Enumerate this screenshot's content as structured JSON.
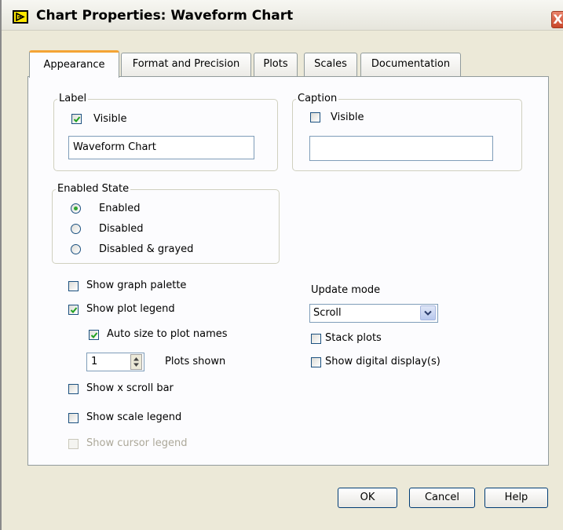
{
  "window": {
    "title": "Chart Properties: Waveform Chart",
    "close_glyph": "X",
    "icon": "labview-icon"
  },
  "tabs": [
    {
      "label": "Appearance",
      "active": true
    },
    {
      "label": "Format and Precision",
      "active": false
    },
    {
      "label": "Plots",
      "active": false
    },
    {
      "label": "Scales",
      "active": false
    },
    {
      "label": "Documentation",
      "active": false
    }
  ],
  "label_group": {
    "title": "Label",
    "visible_label": "Visible",
    "visible_checked": true,
    "text_value": "Waveform Chart"
  },
  "caption_group": {
    "title": "Caption",
    "visible_label": "Visible",
    "visible_checked": false,
    "text_value": ""
  },
  "enabled_state": {
    "title": "Enabled State",
    "options": [
      {
        "label": "Enabled",
        "selected": true
      },
      {
        "label": "Disabled",
        "selected": false
      },
      {
        "label": "Disabled & grayed",
        "selected": false
      }
    ]
  },
  "options": {
    "show_graph_palette": {
      "label": "Show graph palette",
      "checked": false
    },
    "show_plot_legend": {
      "label": "Show plot legend",
      "checked": true
    },
    "auto_size": {
      "label": "Auto size to plot names",
      "checked": true
    },
    "plots_shown": {
      "value": "1",
      "label": "Plots shown"
    },
    "show_x_scroll_bar": {
      "label": "Show x scroll bar",
      "checked": false
    },
    "show_scale_legend": {
      "label": "Show scale legend",
      "checked": false
    },
    "show_cursor_legend": {
      "label": "Show cursor legend",
      "checked": false,
      "disabled": true
    }
  },
  "update": {
    "title": "Update mode",
    "selected": "Scroll",
    "stack_plots": {
      "label": "Stack plots",
      "checked": false
    },
    "show_digital_display": {
      "label": "Show digital display(s)",
      "checked": false
    }
  },
  "buttons": {
    "ok": "OK",
    "cancel": "Cancel",
    "help": "Help"
  },
  "colors": {
    "dialog_bg": "#ece9d8",
    "panel_bg": "#fcfcfe",
    "active_tab_accent": "#f4a435",
    "check_green": "#21a121",
    "close_red": "#c8462a"
  }
}
